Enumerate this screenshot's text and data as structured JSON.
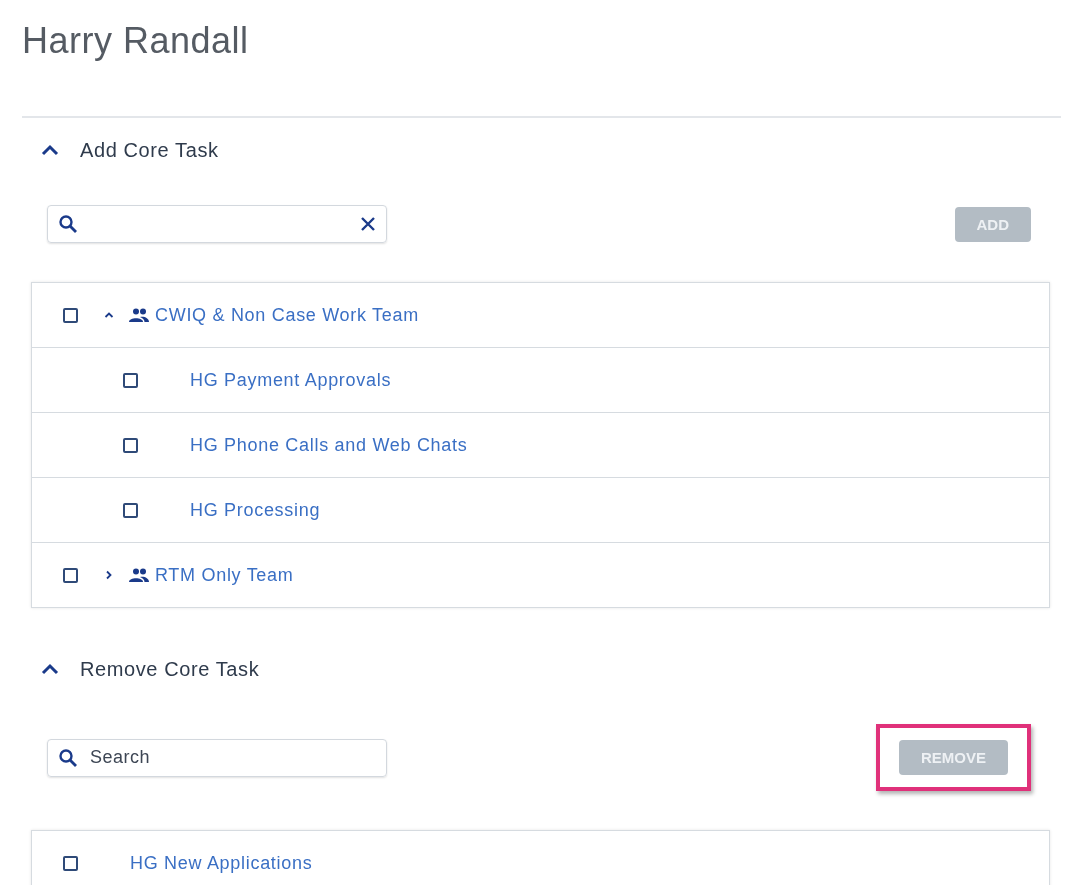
{
  "page": {
    "title": "Harry Randall"
  },
  "sections": [
    {
      "title": "Add Core Task",
      "expanded": true,
      "search": {
        "clear_button": true
      },
      "action": {
        "label": "ADD",
        "disabled": true,
        "highlighted": false
      },
      "items": [
        {
          "kind": "team",
          "label": "CWIQ & Non Case Work Team",
          "checked": false,
          "expanded": true,
          "children": [
            {
              "kind": "task",
              "label": "HG Payment Approvals",
              "checked": false
            },
            {
              "kind": "task",
              "label": "HG Phone Calls and Web Chats",
              "checked": false
            },
            {
              "kind": "task",
              "label": "HG Processing",
              "checked": false
            }
          ]
        },
        {
          "kind": "team",
          "label": "RTM Only Team",
          "checked": false,
          "expanded": false
        }
      ]
    },
    {
      "title": "Remove Core Task",
      "expanded": true,
      "search": {
        "placeholder": "Search"
      },
      "action": {
        "label": "REMOVE",
        "disabled": true,
        "highlighted": true
      },
      "items": [
        {
          "kind": "task",
          "label": "HG New Applications",
          "checked": false
        }
      ]
    }
  ]
}
